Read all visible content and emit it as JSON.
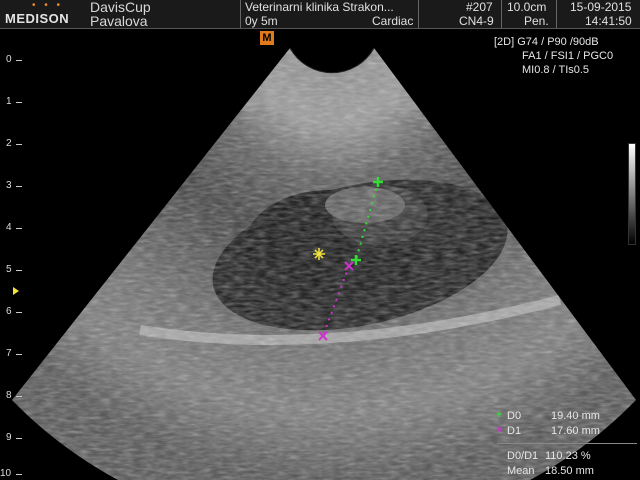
{
  "header": {
    "brand": "MEDISON",
    "patient_name_1": "DavisCup",
    "patient_name_2": "Pavalova",
    "clinic": "Veterinarni klinika Strakon...",
    "age": "0y 5m",
    "preset": "Cardiac",
    "exam_no": "#207",
    "probe": "CN4-9",
    "depth": "10.0cm",
    "mode": "Pen.",
    "date": "15-09-2015",
    "time": "14:41:50"
  },
  "marker": "M",
  "params": {
    "line1": "[2D] G74 / P90 /90dB",
    "line2": "FA1 / FSI1 / PGC0",
    "line3": "MI0.8 / TIs0.5"
  },
  "depth_scale": [
    "0",
    "1",
    "2",
    "3",
    "4",
    "5",
    "6",
    "7",
    "8",
    "9",
    "10"
  ],
  "measurements": {
    "d0_symbol": "+",
    "d0_label": "D0",
    "d0_value": "19.40 mm",
    "d1_symbol": "×",
    "d1_label": "D1",
    "d1_value": "17.60 mm",
    "ratio_label": "D0/D1",
    "ratio_value": "110.23 %",
    "mean_label": "Mean",
    "mean_value": "18.50 mm"
  },
  "colors": {
    "d0": "#33dd33",
    "d1": "#cc33cc",
    "focus": "#f3e43a",
    "marker": "#e07a1a",
    "star": "#f3e43a"
  }
}
